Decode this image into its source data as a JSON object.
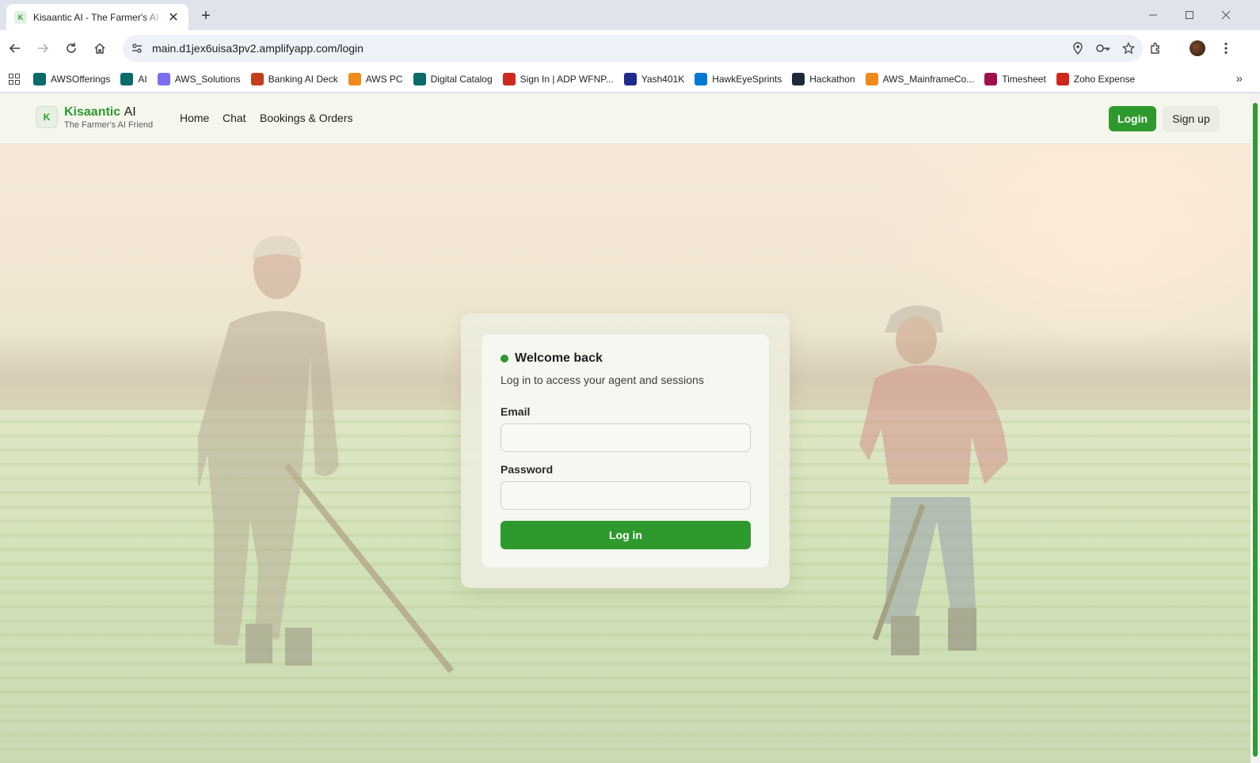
{
  "browser": {
    "tab_title": "Kisaantic AI - The Farmer's AI Friend",
    "tab_favicon": "K",
    "url": "main.d1jex6uisa3pv2.amplifyapp.com/login",
    "bookmarks": [
      {
        "label": "AWSOfferings",
        "icon": "sharepoint-icon",
        "color": "#0b6a6a"
      },
      {
        "label": "AI",
        "icon": "sharepoint-icon",
        "color": "#0b6a6a"
      },
      {
        "label": "AWS_Solutions",
        "icon": "cube-icon",
        "color": "#7b6ef0"
      },
      {
        "label": "Banking AI Deck",
        "icon": "powerpoint-icon",
        "color": "#c43e1c"
      },
      {
        "label": "AWS PC",
        "icon": "box-icon",
        "color": "#f08a1c"
      },
      {
        "label": "Digital Catalog",
        "icon": "sharepoint-icon",
        "color": "#0b6a6a"
      },
      {
        "label": "Sign In | ADP WFNP...",
        "icon": "adp-icon",
        "color": "#d0271d"
      },
      {
        "label": "Yash401K",
        "icon": "jh-icon",
        "color": "#1f2a8a"
      },
      {
        "label": "HawkEyeSprints",
        "icon": "azure-devops-icon",
        "color": "#0078d4"
      },
      {
        "label": "Hackathon",
        "icon": "d-icon",
        "color": "#1c2b39"
      },
      {
        "label": "AWS_MainframeCo...",
        "icon": "aws-box-icon",
        "color": "#f08a1c"
      },
      {
        "label": "Timesheet",
        "icon": "v-icon",
        "color": "#a0104a"
      },
      {
        "label": "Zoho Expense",
        "icon": "zoho-icon",
        "color": "#d0271d"
      }
    ]
  },
  "navbar": {
    "logo_letter": "K",
    "brand_green": "Kisaantic",
    "brand_dark": "AI",
    "tagline": "The Farmer's AI Friend",
    "links": [
      "Home",
      "Chat",
      "Bookings & Orders"
    ],
    "login_label": "Login",
    "signup_label": "Sign up"
  },
  "login_card": {
    "title": "Welcome back",
    "subtitle": "Log in to access your agent and sessions",
    "email_label": "Email",
    "email_value": "",
    "password_label": "Password",
    "password_value": "",
    "submit_label": "Log in"
  },
  "colors": {
    "brand_green": "#2e9a2e"
  }
}
